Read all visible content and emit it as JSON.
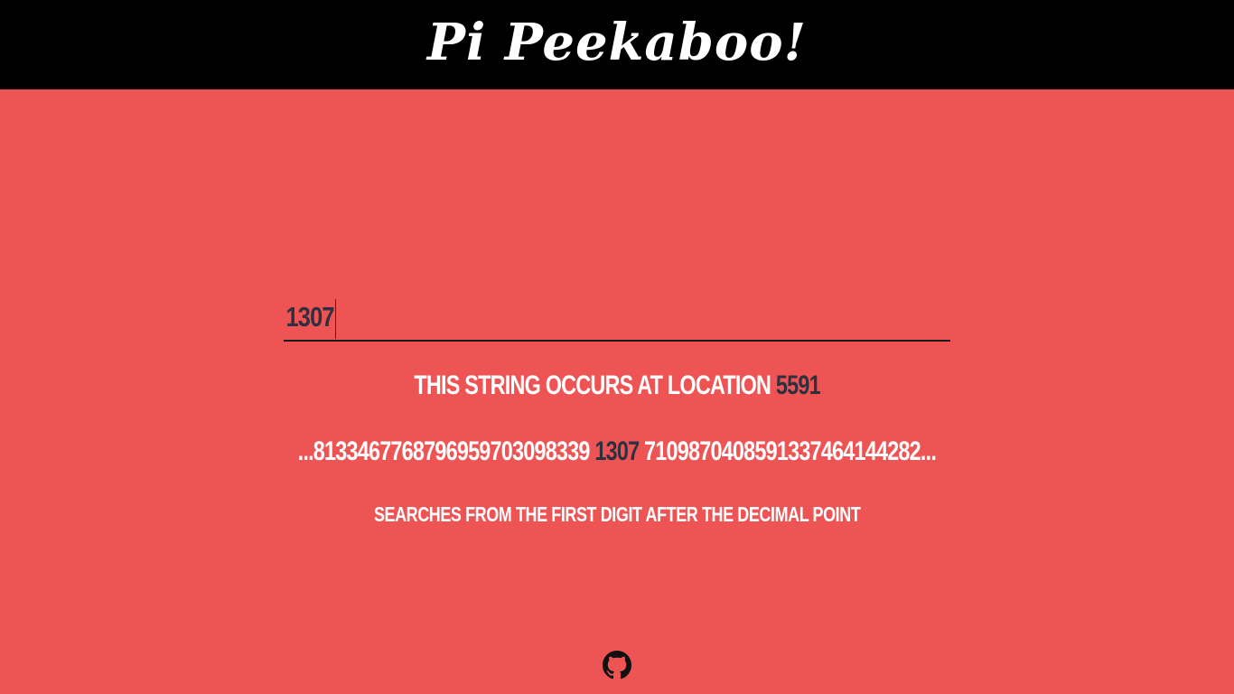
{
  "header": {
    "title": "Pi Peekaboo!"
  },
  "search": {
    "value": "1307",
    "placeholder": ""
  },
  "result": {
    "prefix": "THIS STRING OCCURS AT LOCATION",
    "location": "5591"
  },
  "context": {
    "before": "...8133467768796959703098339",
    "match": "1307",
    "after": "7109870408591337464144282..."
  },
  "note": {
    "text": "SEARCHES FROM THE FIRST DIGIT AFTER THE DECIMAL POINT"
  },
  "footer": {
    "icon": "github-icon"
  },
  "colors": {
    "background": "#ef5454",
    "header": "#000000",
    "highlight": "#2e3040",
    "text": "#ffffff"
  }
}
